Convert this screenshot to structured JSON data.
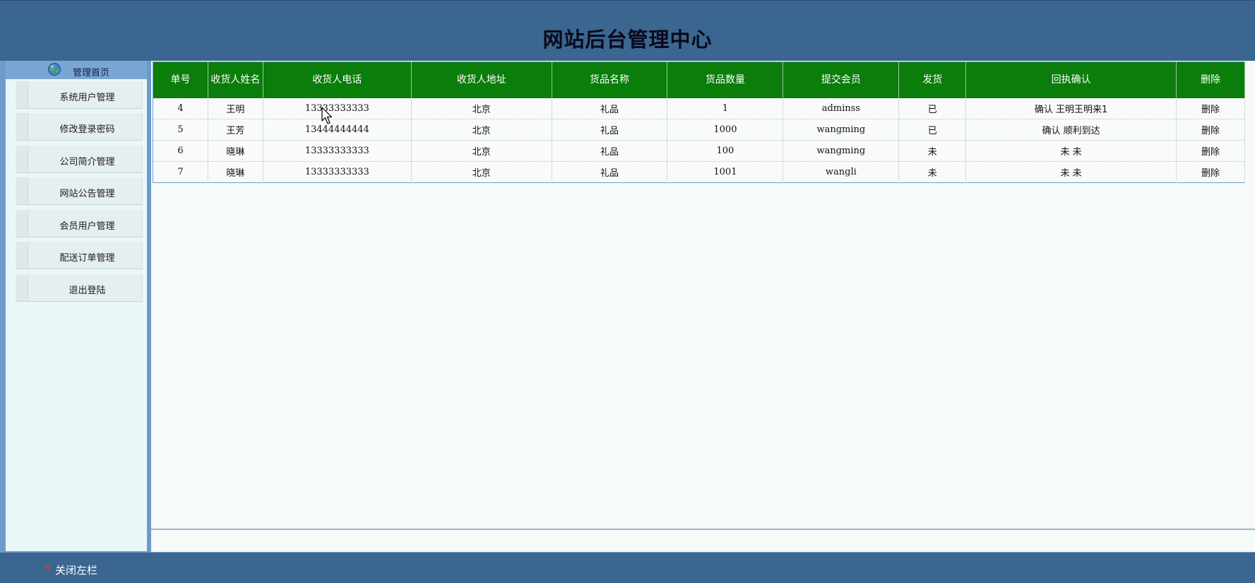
{
  "header": {
    "title": "网站后台管理中心"
  },
  "sidebar": {
    "home_label": "管理首页",
    "home_icon": "globe-icon",
    "items": [
      {
        "label": "系统用户管理"
      },
      {
        "label": "修改登录密码"
      },
      {
        "label": "公司简介管理"
      },
      {
        "label": "网站公告管理"
      },
      {
        "label": "会员用户管理"
      },
      {
        "label": "配送订单管理"
      },
      {
        "label": "退出登陆"
      }
    ]
  },
  "table": {
    "columns": [
      "单号",
      "收货人姓名",
      "收货人电话",
      "收货人地址",
      "货品名称",
      "货品数量",
      "提交会员",
      "发货",
      "回执确认",
      "删除"
    ],
    "rows": [
      {
        "id": "4",
        "name": "王明",
        "phone": "13333333333",
        "address": "北京",
        "product": "礼品",
        "qty": "1",
        "member": "adminss",
        "shipped": "已",
        "receipt": "确认 王明王明来1",
        "delete": "删除"
      },
      {
        "id": "5",
        "name": "王芳",
        "phone": "13444444444",
        "address": "北京",
        "product": "礼品",
        "qty": "1000",
        "member": "wangming",
        "shipped": "已",
        "receipt": "确认 顺利到达",
        "delete": "删除"
      },
      {
        "id": "6",
        "name": "晓琳",
        "phone": "13333333333",
        "address": "北京",
        "product": "礼品",
        "qty": "100",
        "member": "wangming",
        "shipped": "未",
        "receipt": "未 未",
        "delete": "删除"
      },
      {
        "id": "7",
        "name": "晓琳",
        "phone": "13333333333",
        "address": "北京",
        "product": "礼品",
        "qty": "1001",
        "member": "wangli",
        "shipped": "未",
        "receipt": "未 未",
        "delete": "删除"
      }
    ]
  },
  "footer": {
    "close_icon": "close-icon",
    "close_label": "关闭左栏"
  },
  "colors": {
    "banner": "#3a6690",
    "table_header": "#0a7d0a",
    "sidebar": "#6c9bcb",
    "close_x": "#e23b3b"
  }
}
